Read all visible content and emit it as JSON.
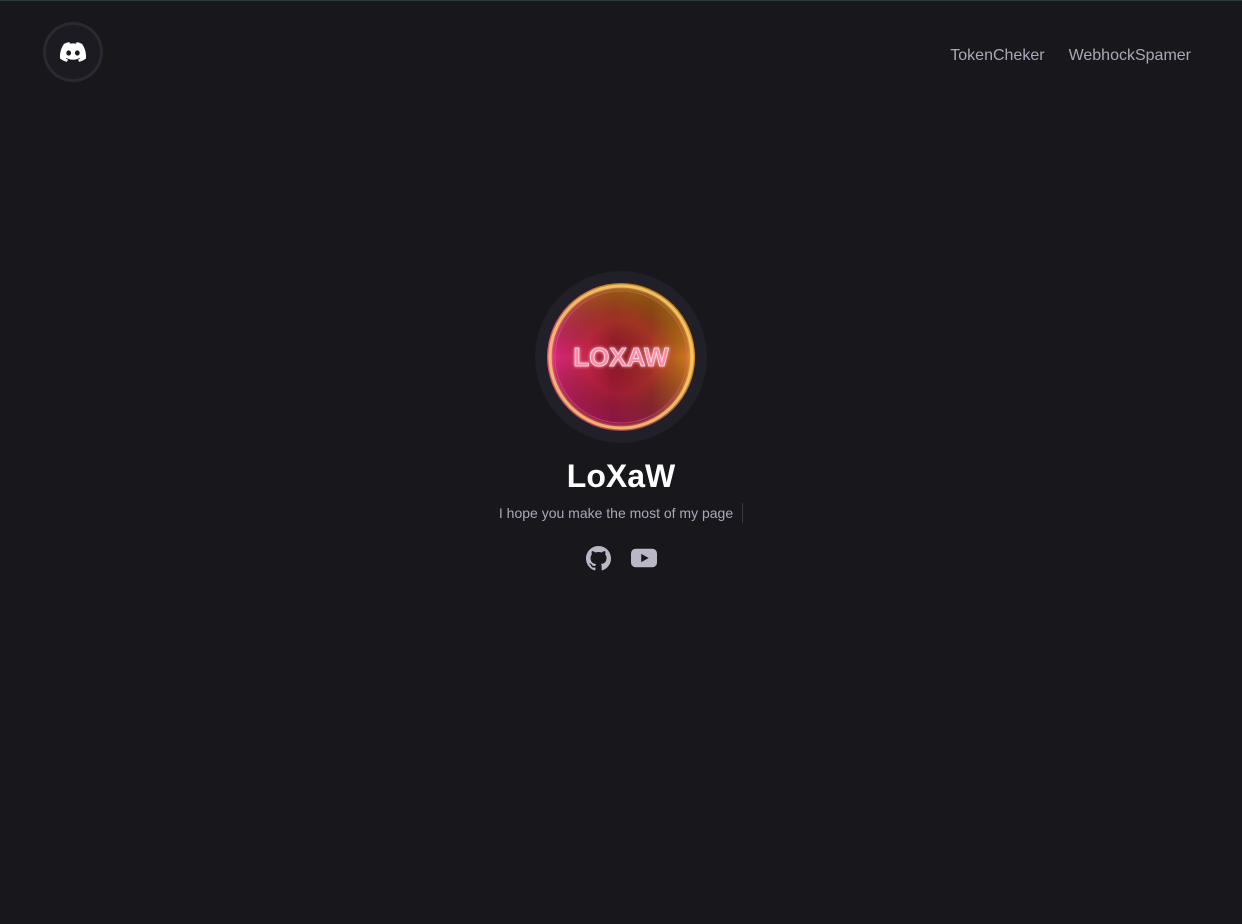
{
  "header": {
    "logo_icon": "discord-icon",
    "nav": [
      {
        "label": "TokenCheker"
      },
      {
        "label": "WebhockSpamer"
      }
    ]
  },
  "profile": {
    "avatar_text": "LOXAW",
    "username": "LoXaW",
    "tagline": "I hope you make the most of my page",
    "socials": [
      {
        "icon": "github-icon"
      },
      {
        "icon": "youtube-icon"
      }
    ]
  },
  "colors": {
    "background": "#18171c",
    "nav_text": "#a8a8b8",
    "username": "#ffffff",
    "icon": "#b8b8c6"
  }
}
